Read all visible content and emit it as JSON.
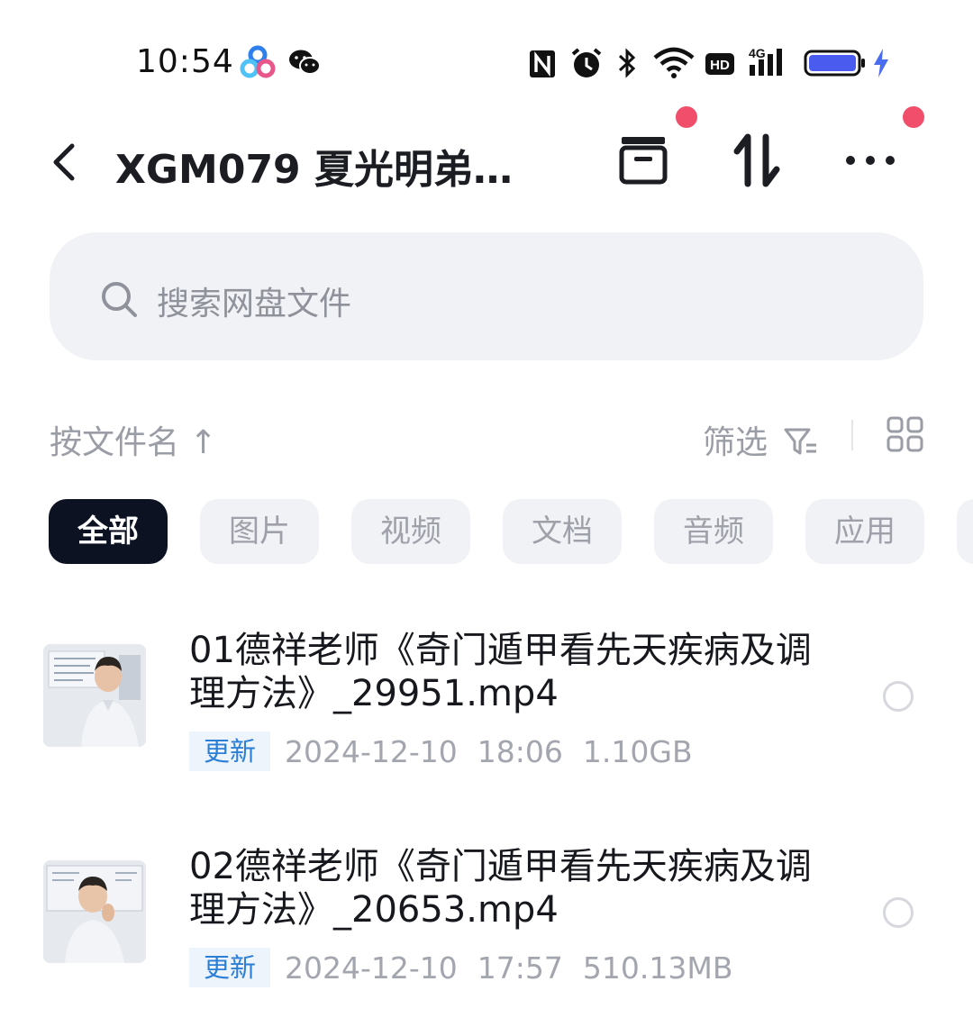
{
  "status_bar": {
    "time": "10:54",
    "icons": [
      "baidu-netdisk-icon",
      "wechat-icon",
      "nfc-icon",
      "alarm-icon",
      "bluetooth-icon",
      "wifi-icon",
      "hd-icon",
      "4g-signal-icon",
      "battery-icon",
      "charging-icon"
    ]
  },
  "header": {
    "title": "XGM079 夏光明弟…",
    "actions": [
      "back-icon",
      "transfer-box-icon",
      "sort-arrows-icon",
      "more-icon"
    ]
  },
  "search": {
    "placeholder": "搜索网盘文件"
  },
  "toolbar": {
    "sort_label": "按文件名 ↑",
    "filter_label": "筛选"
  },
  "categories": [
    "全部",
    "图片",
    "视频",
    "文档",
    "音频",
    "应用"
  ],
  "active_category": "全部",
  "files": [
    {
      "name": "01德祥老师《奇门遁甲看先天疾病及调理方法》_29951.mp4",
      "tag": "更新",
      "date": "2024-12-10",
      "time": "18:06",
      "size": "1.10GB"
    },
    {
      "name": "02德祥老师《奇门遁甲看先天疾病及调理方法》_20653.mp4",
      "tag": "更新",
      "date": "2024-12-10",
      "time": "17:57",
      "size": "510.13MB"
    }
  ],
  "colors": {
    "accent_dark": "#0c1221",
    "badge_red": "#f04e6a",
    "tag_blue": "#2b7fd6",
    "chip_bg": "#f1f2f6"
  }
}
